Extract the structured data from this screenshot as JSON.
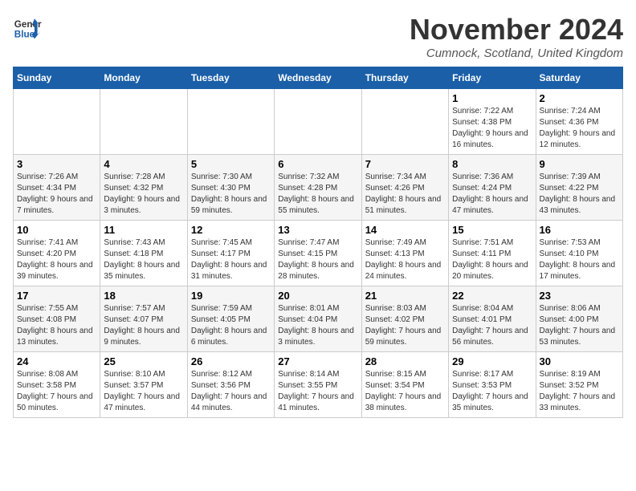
{
  "header": {
    "logo_general": "General",
    "logo_blue": "Blue",
    "month_title": "November 2024",
    "location": "Cumnock, Scotland, United Kingdom"
  },
  "weekdays": [
    "Sunday",
    "Monday",
    "Tuesday",
    "Wednesday",
    "Thursday",
    "Friday",
    "Saturday"
  ],
  "weeks": [
    [
      {
        "day": "",
        "info": ""
      },
      {
        "day": "",
        "info": ""
      },
      {
        "day": "",
        "info": ""
      },
      {
        "day": "",
        "info": ""
      },
      {
        "day": "",
        "info": ""
      },
      {
        "day": "1",
        "info": "Sunrise: 7:22 AM\nSunset: 4:38 PM\nDaylight: 9 hours and 16 minutes."
      },
      {
        "day": "2",
        "info": "Sunrise: 7:24 AM\nSunset: 4:36 PM\nDaylight: 9 hours and 12 minutes."
      }
    ],
    [
      {
        "day": "3",
        "info": "Sunrise: 7:26 AM\nSunset: 4:34 PM\nDaylight: 9 hours and 7 minutes."
      },
      {
        "day": "4",
        "info": "Sunrise: 7:28 AM\nSunset: 4:32 PM\nDaylight: 9 hours and 3 minutes."
      },
      {
        "day": "5",
        "info": "Sunrise: 7:30 AM\nSunset: 4:30 PM\nDaylight: 8 hours and 59 minutes."
      },
      {
        "day": "6",
        "info": "Sunrise: 7:32 AM\nSunset: 4:28 PM\nDaylight: 8 hours and 55 minutes."
      },
      {
        "day": "7",
        "info": "Sunrise: 7:34 AM\nSunset: 4:26 PM\nDaylight: 8 hours and 51 minutes."
      },
      {
        "day": "8",
        "info": "Sunrise: 7:36 AM\nSunset: 4:24 PM\nDaylight: 8 hours and 47 minutes."
      },
      {
        "day": "9",
        "info": "Sunrise: 7:39 AM\nSunset: 4:22 PM\nDaylight: 8 hours and 43 minutes."
      }
    ],
    [
      {
        "day": "10",
        "info": "Sunrise: 7:41 AM\nSunset: 4:20 PM\nDaylight: 8 hours and 39 minutes."
      },
      {
        "day": "11",
        "info": "Sunrise: 7:43 AM\nSunset: 4:18 PM\nDaylight: 8 hours and 35 minutes."
      },
      {
        "day": "12",
        "info": "Sunrise: 7:45 AM\nSunset: 4:17 PM\nDaylight: 8 hours and 31 minutes."
      },
      {
        "day": "13",
        "info": "Sunrise: 7:47 AM\nSunset: 4:15 PM\nDaylight: 8 hours and 28 minutes."
      },
      {
        "day": "14",
        "info": "Sunrise: 7:49 AM\nSunset: 4:13 PM\nDaylight: 8 hours and 24 minutes."
      },
      {
        "day": "15",
        "info": "Sunrise: 7:51 AM\nSunset: 4:11 PM\nDaylight: 8 hours and 20 minutes."
      },
      {
        "day": "16",
        "info": "Sunrise: 7:53 AM\nSunset: 4:10 PM\nDaylight: 8 hours and 17 minutes."
      }
    ],
    [
      {
        "day": "17",
        "info": "Sunrise: 7:55 AM\nSunset: 4:08 PM\nDaylight: 8 hours and 13 minutes."
      },
      {
        "day": "18",
        "info": "Sunrise: 7:57 AM\nSunset: 4:07 PM\nDaylight: 8 hours and 9 minutes."
      },
      {
        "day": "19",
        "info": "Sunrise: 7:59 AM\nSunset: 4:05 PM\nDaylight: 8 hours and 6 minutes."
      },
      {
        "day": "20",
        "info": "Sunrise: 8:01 AM\nSunset: 4:04 PM\nDaylight: 8 hours and 3 minutes."
      },
      {
        "day": "21",
        "info": "Sunrise: 8:03 AM\nSunset: 4:02 PM\nDaylight: 7 hours and 59 minutes."
      },
      {
        "day": "22",
        "info": "Sunrise: 8:04 AM\nSunset: 4:01 PM\nDaylight: 7 hours and 56 minutes."
      },
      {
        "day": "23",
        "info": "Sunrise: 8:06 AM\nSunset: 4:00 PM\nDaylight: 7 hours and 53 minutes."
      }
    ],
    [
      {
        "day": "24",
        "info": "Sunrise: 8:08 AM\nSunset: 3:58 PM\nDaylight: 7 hours and 50 minutes."
      },
      {
        "day": "25",
        "info": "Sunrise: 8:10 AM\nSunset: 3:57 PM\nDaylight: 7 hours and 47 minutes."
      },
      {
        "day": "26",
        "info": "Sunrise: 8:12 AM\nSunset: 3:56 PM\nDaylight: 7 hours and 44 minutes."
      },
      {
        "day": "27",
        "info": "Sunrise: 8:14 AM\nSunset: 3:55 PM\nDaylight: 7 hours and 41 minutes."
      },
      {
        "day": "28",
        "info": "Sunrise: 8:15 AM\nSunset: 3:54 PM\nDaylight: 7 hours and 38 minutes."
      },
      {
        "day": "29",
        "info": "Sunrise: 8:17 AM\nSunset: 3:53 PM\nDaylight: 7 hours and 35 minutes."
      },
      {
        "day": "30",
        "info": "Sunrise: 8:19 AM\nSunset: 3:52 PM\nDaylight: 7 hours and 33 minutes."
      }
    ]
  ]
}
